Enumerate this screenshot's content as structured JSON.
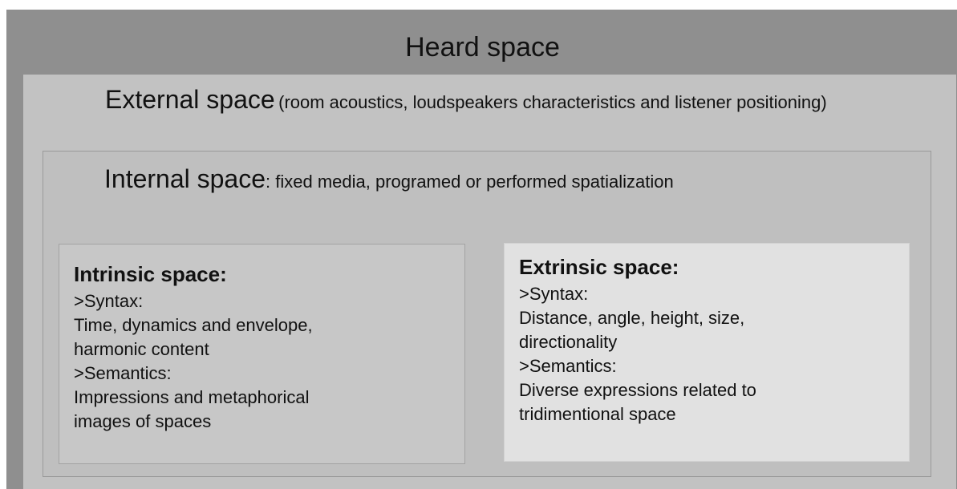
{
  "heard": {
    "title": "Heard space"
  },
  "external": {
    "title": "External space",
    "note": "(room acoustics, loudspeakers characteristics and listener positioning)"
  },
  "internal": {
    "title": "Internal space",
    "note": ": fixed media, programed or performed spatialization"
  },
  "intrinsic": {
    "title": "Intrinsic space:",
    "lines": [
      ">Syntax:",
      "Time, dynamics and envelope,",
      "harmonic content",
      ">Semantics:",
      "Impressions and metaphorical",
      "images of spaces"
    ]
  },
  "extrinsic": {
    "title": "Extrinsic space:",
    "lines": [
      ">Syntax:",
      "Distance, angle, height, size,",
      "directionality",
      ">Semantics:",
      "Diverse expressions related to",
      "tridimentional space"
    ]
  }
}
